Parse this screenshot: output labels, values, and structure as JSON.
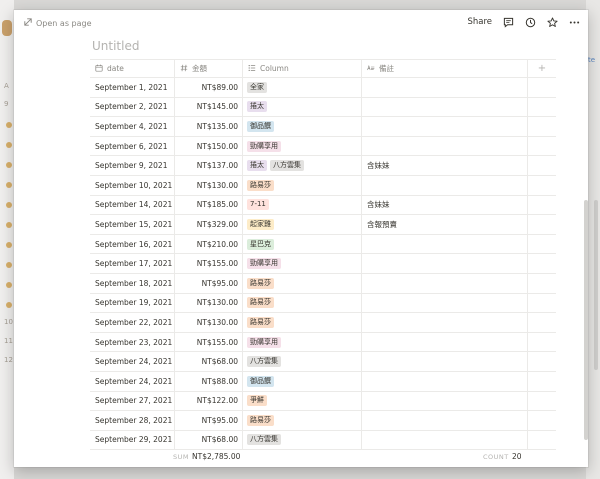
{
  "background": {
    "left_marks": [
      "A",
      "9",
      "10",
      "11",
      "12"
    ],
    "right_link": "te"
  },
  "topbar": {
    "open_as_page": "Open as page",
    "share": "Share",
    "icons": [
      "comment-icon",
      "history-icon",
      "star-icon",
      "more-icon"
    ]
  },
  "page": {
    "title": "Untitled"
  },
  "table": {
    "headers": {
      "date": "date",
      "amount": "金額",
      "column": "Column",
      "note": "備註",
      "add": "+"
    },
    "rows": [
      {
        "date": "September 1, 2021",
        "amount": "NT$89.00",
        "tags": [
          {
            "text": "全家",
            "color": "#e3e2e0"
          }
        ],
        "note": ""
      },
      {
        "date": "September 2, 2021",
        "amount": "NT$145.00",
        "tags": [
          {
            "text": "捲太",
            "color": "#e8deee"
          }
        ],
        "note": ""
      },
      {
        "date": "September 4, 2021",
        "amount": "NT$135.00",
        "tags": [
          {
            "text": "御品饌",
            "color": "#d3e5ef"
          }
        ],
        "note": ""
      },
      {
        "date": "September 6, 2021",
        "amount": "NT$150.00",
        "tags": [
          {
            "text": "勁購享用",
            "color": "#f5e0e9"
          }
        ],
        "note": ""
      },
      {
        "date": "September 9, 2021",
        "amount": "NT$137.00",
        "tags": [
          {
            "text": "捲太",
            "color": "#e8deee"
          },
          {
            "text": "八方雲集",
            "color": "#e3e2e0"
          }
        ],
        "note": "含妹妹"
      },
      {
        "date": "September 10, 2021",
        "amount": "NT$130.00",
        "tags": [
          {
            "text": "路易莎",
            "color": "#fadec9"
          }
        ],
        "note": ""
      },
      {
        "date": "September 14, 2021",
        "amount": "NT$185.00",
        "tags": [
          {
            "text": "7-11",
            "color": "#ffe2dd"
          }
        ],
        "note": "含妹妹"
      },
      {
        "date": "September 15, 2021",
        "amount": "NT$329.00",
        "tags": [
          {
            "text": "起家雞",
            "color": "#fdecc8"
          }
        ],
        "note": "含報預賣"
      },
      {
        "date": "September 16, 2021",
        "amount": "NT$210.00",
        "tags": [
          {
            "text": "星巴克",
            "color": "#dbeddb"
          }
        ],
        "note": ""
      },
      {
        "date": "September 17, 2021",
        "amount": "NT$155.00",
        "tags": [
          {
            "text": "勁購享用",
            "color": "#f5e0e9"
          }
        ],
        "note": ""
      },
      {
        "date": "September 18, 2021",
        "amount": "NT$95.00",
        "tags": [
          {
            "text": "路易莎",
            "color": "#fadec9"
          }
        ],
        "note": ""
      },
      {
        "date": "September 19, 2021",
        "amount": "NT$130.00",
        "tags": [
          {
            "text": "路易莎",
            "color": "#fadec9"
          }
        ],
        "note": ""
      },
      {
        "date": "September 22, 2021",
        "amount": "NT$130.00",
        "tags": [
          {
            "text": "路易莎",
            "color": "#fadec9"
          }
        ],
        "note": ""
      },
      {
        "date": "September 23, 2021",
        "amount": "NT$155.00",
        "tags": [
          {
            "text": "勁購享用",
            "color": "#f5e0e9"
          }
        ],
        "note": ""
      },
      {
        "date": "September 24, 2021",
        "amount": "NT$68.00",
        "tags": [
          {
            "text": "八方雲集",
            "color": "#e3e2e0"
          }
        ],
        "note": ""
      },
      {
        "date": "September 24, 2021",
        "amount": "NT$88.00",
        "tags": [
          {
            "text": "御品饌",
            "color": "#d3e5ef"
          }
        ],
        "note": ""
      },
      {
        "date": "September 27, 2021",
        "amount": "NT$122.00",
        "tags": [
          {
            "text": "爭鮮",
            "color": "#fadec9"
          }
        ],
        "note": ""
      },
      {
        "date": "September 28, 2021",
        "amount": "NT$95.00",
        "tags": [
          {
            "text": "路易莎",
            "color": "#fadec9"
          }
        ],
        "note": ""
      },
      {
        "date": "September 29, 2021",
        "amount": "NT$68.00",
        "tags": [
          {
            "text": "八方雲集",
            "color": "#e3e2e0"
          }
        ],
        "note": ""
      }
    ]
  },
  "footer": {
    "sum_label": "SUM",
    "sum_value": "NT$2,785.00",
    "count_label": "COUNT",
    "count_value": "20"
  }
}
